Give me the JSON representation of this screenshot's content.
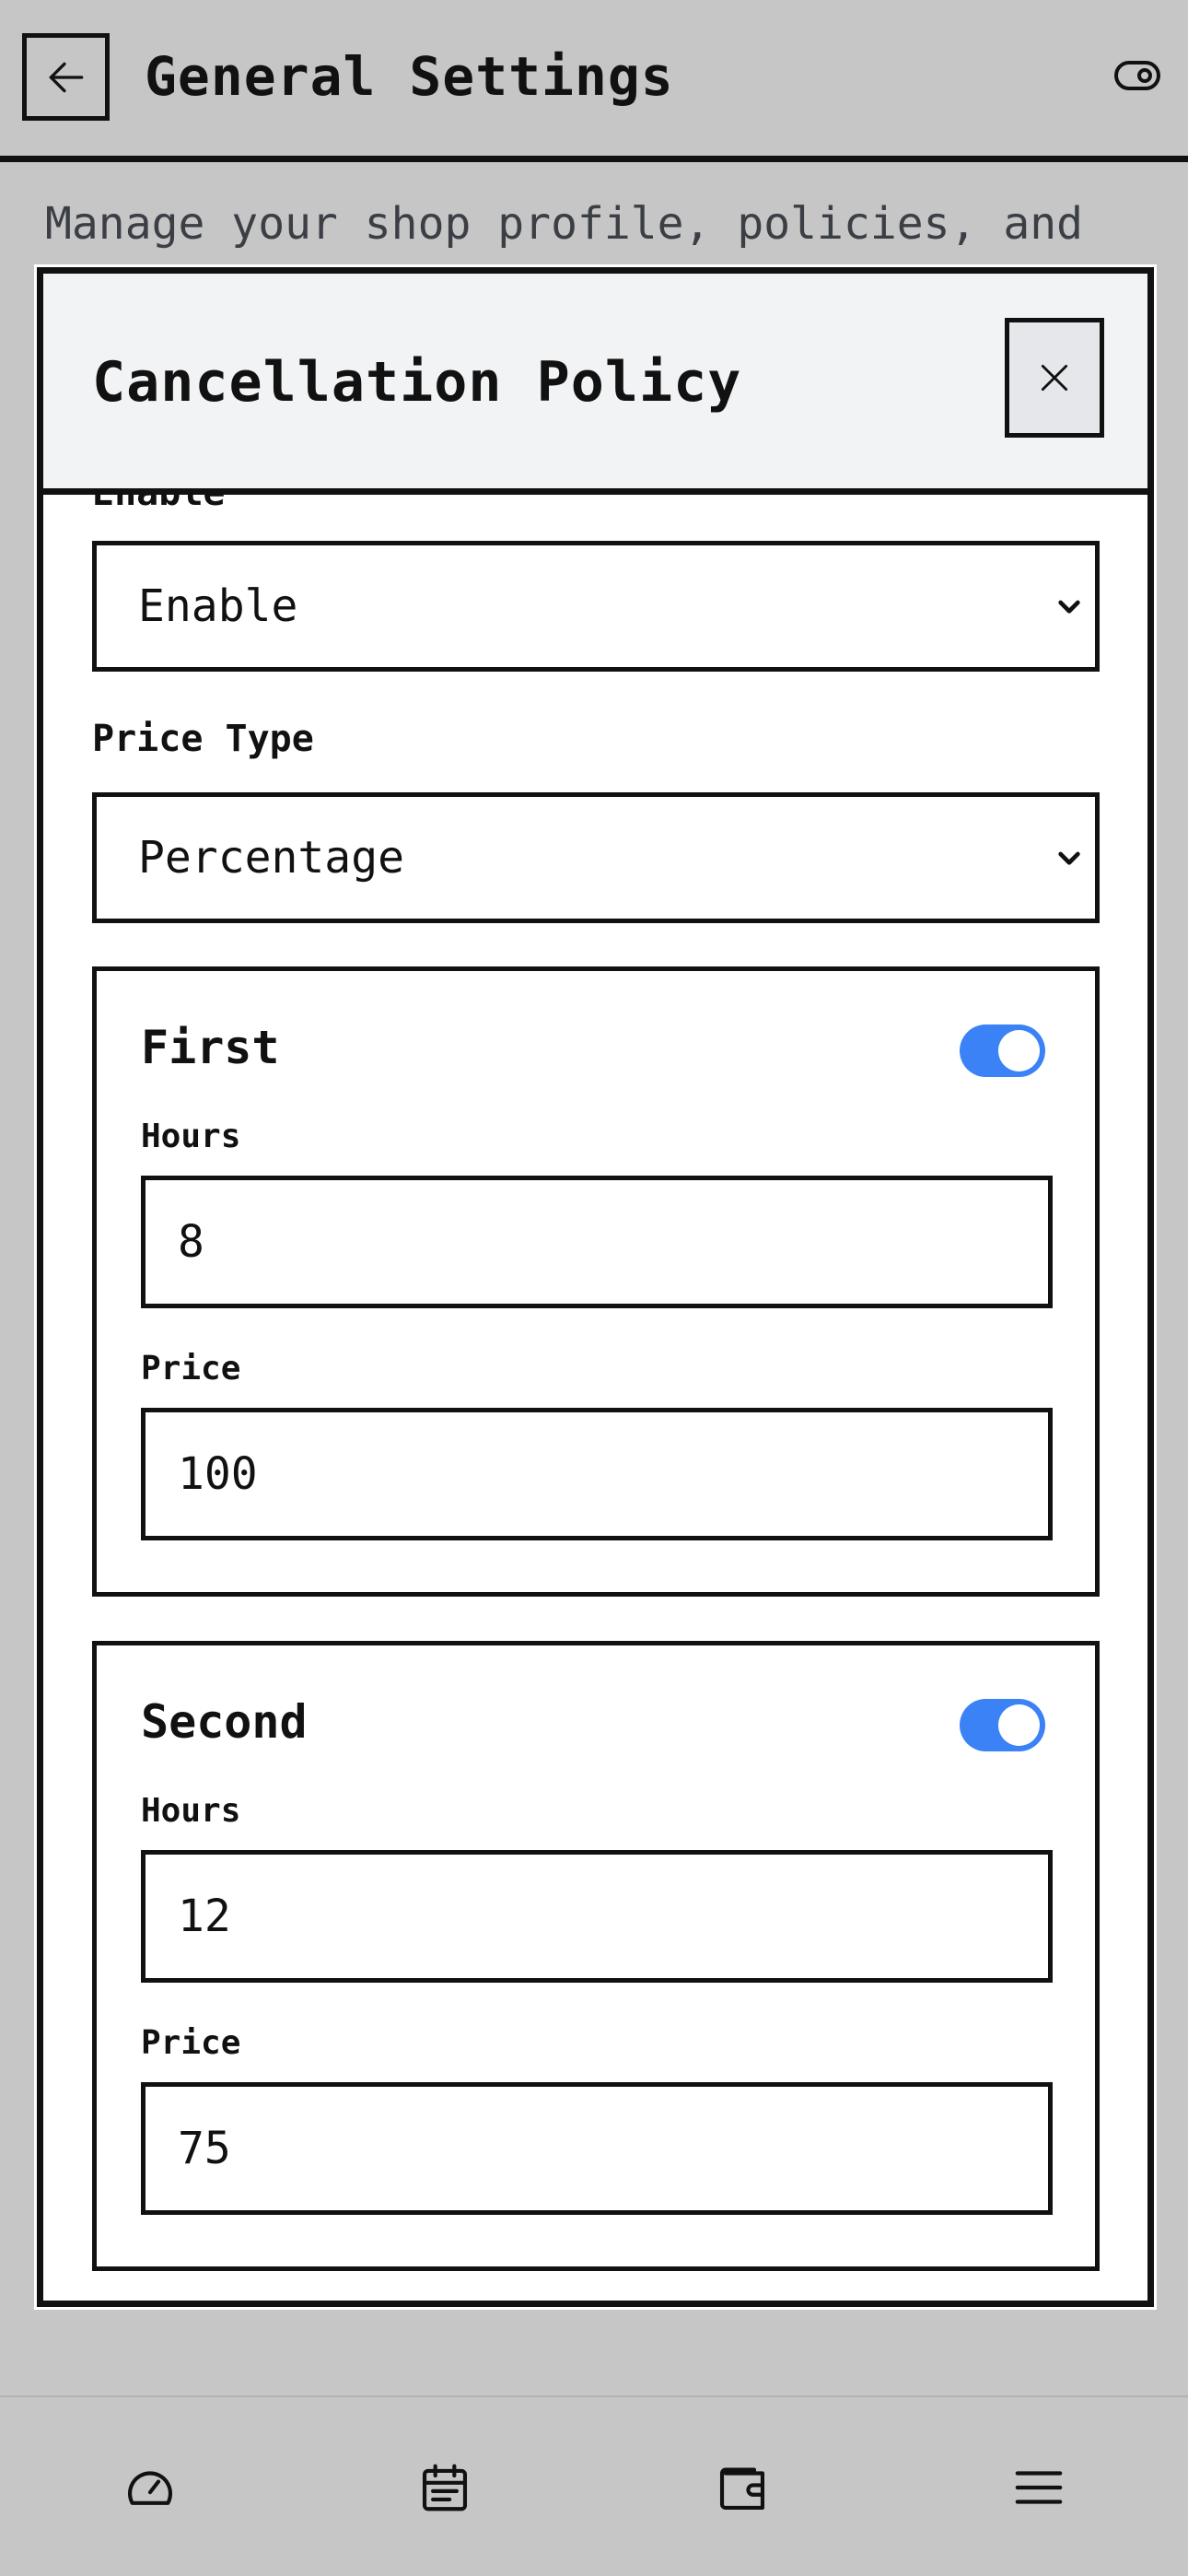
{
  "header": {
    "title": "General Settings",
    "back_icon": "arrow-left-icon",
    "toggle_icon": "toggle-icon"
  },
  "page": {
    "description": "Manage your shop profile, policies, and"
  },
  "modal": {
    "title": "Cancellation Policy",
    "close_icon": "close-icon",
    "enable_label": "Enable",
    "enable_value": "Enable",
    "price_type_label": "Price Type",
    "price_type_value": "Percentage",
    "tiers": [
      {
        "title": "First",
        "enabled": true,
        "hours_label": "Hours",
        "hours_value": "8",
        "price_label": "Price",
        "price_value": "100"
      },
      {
        "title": "Second",
        "enabled": true,
        "hours_label": "Hours",
        "hours_value": "12",
        "price_label": "Price",
        "price_value": "75"
      }
    ]
  },
  "bottom_nav": {
    "items": [
      "dashboard-icon",
      "calendar-icon",
      "wallet-icon",
      "menu-icon"
    ]
  },
  "colors": {
    "accent": "#3b82f6",
    "backdrop": "#c6c6c6",
    "modal_header_bg": "#f2f3f5"
  }
}
